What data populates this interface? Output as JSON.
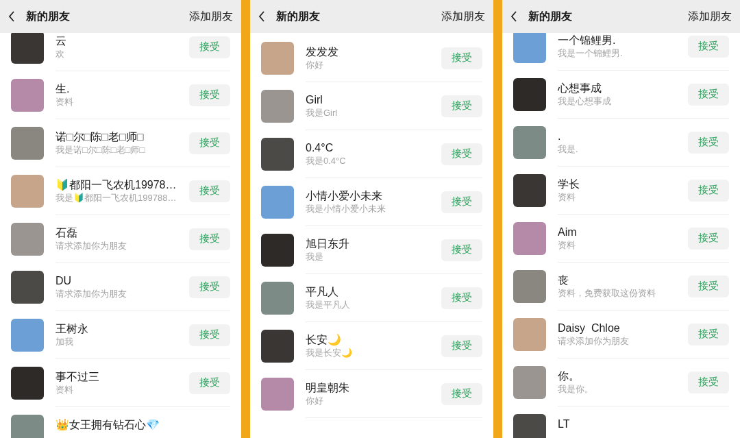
{
  "panels": [
    {
      "header": {
        "title": "新的朋友",
        "action": "添加朋友"
      },
      "rows": [
        {
          "name": "云",
          "note": "欢",
          "button": "接受"
        },
        {
          "name": "生.",
          "note": "资料",
          "button": "接受"
        },
        {
          "name": "诺□尔□陈□老□师□",
          "note": "我是诺□尔□陈□老□师□",
          "button": "接受"
        },
        {
          "name": "🔰都阳一飞农机19978…",
          "note": "我是🔰都阳一飞农机199788…",
          "button": "接受"
        },
        {
          "name": "石磊",
          "note": "请求添加你为朋友",
          "button": "接受"
        },
        {
          "name": "DU",
          "note": "请求添加你为朋友",
          "button": "接受"
        },
        {
          "name": "王树永",
          "note": "加我",
          "button": "接受"
        },
        {
          "name": "事不过三",
          "note": "资料",
          "button": "接受"
        },
        {
          "name": "👑女王拥有钻石心💎"
        }
      ]
    },
    {
      "header": {
        "title": "新的朋友",
        "action": "添加朋友"
      },
      "rows": [
        {
          "name": "发发发",
          "note": "你好",
          "button": "接受"
        },
        {
          "name": "Girl",
          "note": "我是Girl",
          "button": "接受"
        },
        {
          "name": "0.4°C",
          "note": "我是0.4°C",
          "button": "接受"
        },
        {
          "name": "小情小爱小未来",
          "note": "我是小情小爱小未来",
          "button": "接受"
        },
        {
          "name": "旭日东升",
          "note": "我是",
          "button": "接受"
        },
        {
          "name": "平凡人",
          "note": "我是平凡人",
          "button": "接受"
        },
        {
          "name": "长安🌙",
          "note": "我是长安🌙",
          "button": "接受"
        },
        {
          "name": "明皇朝朱",
          "note": "你好",
          "button": "接受"
        }
      ]
    },
    {
      "header": {
        "title": "新的朋友",
        "action": "添加朋友"
      },
      "rows": [
        {
          "name": "一个锦鲤男.",
          "note": "我是一个锦鲤男.",
          "button": "接受"
        },
        {
          "name": "心想事成",
          "note": "我是心想事成",
          "button": "接受"
        },
        {
          "name": ".",
          "note": "我是.",
          "button": "接受"
        },
        {
          "name": "学长",
          "note": "资料",
          "button": "接受"
        },
        {
          "name": "Aim",
          "note": "资料",
          "button": "接受"
        },
        {
          "name": "丧",
          "note": "资料，免费获取这份资料",
          "button": "接受"
        },
        {
          "name": "Daisy  Chloe",
          "note": "请求添加你为朋友",
          "button": "接受"
        },
        {
          "name": "你。",
          "note": "我是你。",
          "button": "接受"
        },
        {
          "name": "LT"
        }
      ]
    }
  ]
}
